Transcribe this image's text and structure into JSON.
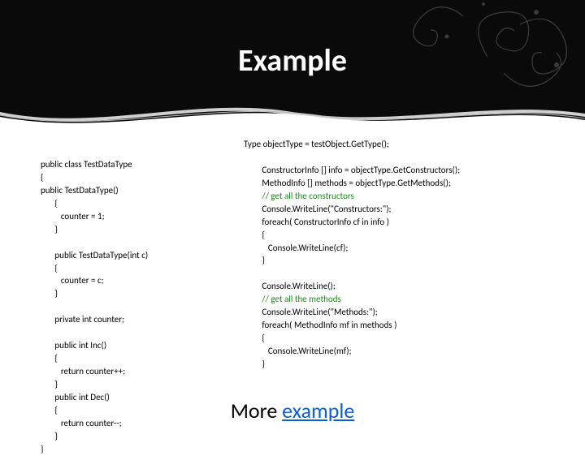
{
  "title": "Example",
  "left_code": "public class TestDataType\n{\npublic TestDataType()\n       {\n          counter = 1;\n       }\n\n       public TestDataType(int c)\n       {\n          counter = c;\n       }\n\n       private int counter;\n\n       public int Inc()\n       {\n          return counter++;\n       }\n       public int Dec()\n       {\n          return counter--;\n       }\n}",
  "right_code_1": "Type objectType = testObject.GetType();\n\n         ConstructorInfo [] info = objectType.GetConstructors();\n         MethodInfo [] methods = objectType.GetMethods();\n",
  "right_comment_1": "         // get all the constructors",
  "right_code_2": "\n         Console.WriteLine(\"Constructors:\");\n         foreach( ConstructorInfo cf in info )\n         {\n            Console.WriteLine(cf);\n         }\n\n         Console.WriteLine();\n",
  "right_comment_2": "         // get all the methods",
  "right_code_3": "\n         Console.WriteLine(\"Methods:\");\n         foreach( MethodInfo mf in methods )\n         {\n            Console.WriteLine(mf);\n         }",
  "footer_pre": "More ",
  "footer_link": "example"
}
